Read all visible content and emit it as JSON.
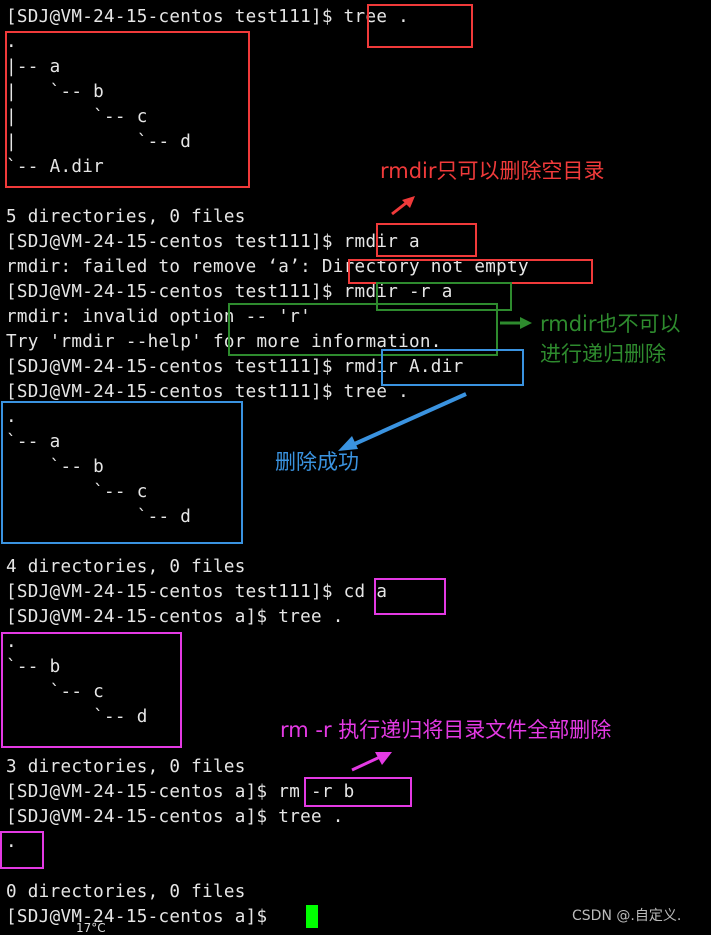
{
  "terminal": {
    "lines": [
      "[SDJ@VM-24-15-centos test111]$ tree .",
      ".",
      "|-- a",
      "|   `-- b",
      "|       `-- c",
      "|           `-- d",
      "`-- A.dir",
      "",
      "5 directories, 0 files",
      "[SDJ@VM-24-15-centos test111]$ rmdir a",
      "rmdir: failed to remove ‘a’: Directory not empty",
      "[SDJ@VM-24-15-centos test111]$ rmdir -r a",
      "rmdir: invalid option -- 'r'",
      "Try 'rmdir --help' for more information.",
      "[SDJ@VM-24-15-centos test111]$ rmdir A.dir",
      "[SDJ@VM-24-15-centos test111]$ tree .",
      ".",
      "`-- a",
      "    `-- b",
      "        `-- c",
      "            `-- d",
      "",
      "4 directories, 0 files",
      "[SDJ@VM-24-15-centos test111]$ cd a",
      "[SDJ@VM-24-15-centos a]$ tree .",
      ".",
      "`-- b",
      "    `-- c",
      "        `-- d",
      "",
      "3 directories, 0 files",
      "[SDJ@VM-24-15-centos a]$ rm -r b",
      "[SDJ@VM-24-15-centos a]$ tree .",
      ".",
      "",
      "0 directories, 0 files",
      "[SDJ@VM-24-15-centos a]$ "
    ]
  },
  "annotations": {
    "rmdir_empty_only": "rmdir只可以删除空目录",
    "rmdir_no_recursive_1": "rmdir也不可以",
    "rmdir_no_recursive_2": "进行递归删除",
    "delete_success": "删除成功",
    "rm_recursive": "rm -r 执行递归将目录文件全部删除"
  },
  "colors": {
    "red": "#f03a3a",
    "green": "#2e8b2e",
    "blue": "#3a93e0",
    "magenta": "#e43ae4",
    "cursor": "#00ff00"
  },
  "watermark": "CSDN @.自定义.",
  "taskbar_temp": "17°C"
}
